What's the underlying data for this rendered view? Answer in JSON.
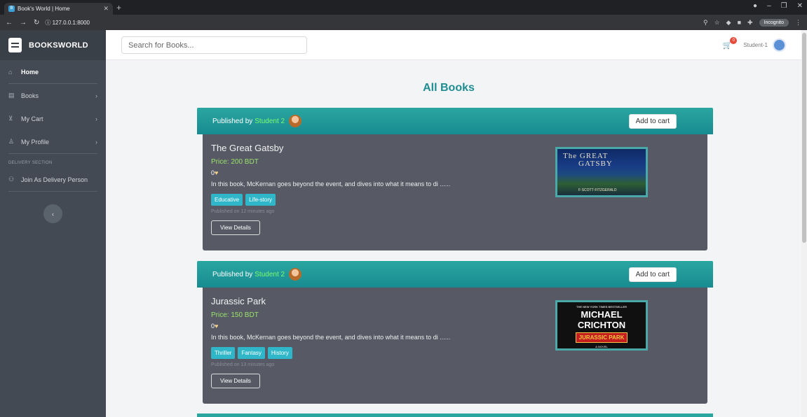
{
  "browser": {
    "tab_title": "Book's World | Home",
    "tab_close": "✕",
    "new_tab": "+",
    "url": "ⓘ 127.0.0.1:8000",
    "incognito_label": "Incognito"
  },
  "sidebar": {
    "brand": "BOOKSWORLD",
    "items": [
      {
        "label": "Home",
        "icon": "home-icon"
      },
      {
        "label": "Books",
        "icon": "book-icon"
      },
      {
        "label": "My Cart",
        "icon": "cart-icon"
      },
      {
        "label": "My Profile",
        "icon": "user-icon"
      }
    ],
    "section_heading": "DELIVERY SECTION",
    "delivery_item": "Join As Delivery Person"
  },
  "topbar": {
    "search_placeholder": "Search for Books...",
    "cart_count": "0",
    "username": "Student-1"
  },
  "main": {
    "title": "All Books",
    "published_by_label": "Published by",
    "add_to_cart_label": "Add to cart",
    "view_details_label": "View Details",
    "books": [
      {
        "publisher": "Student 2",
        "title": "The Great Gatsby",
        "price": "Price: 200 BDT",
        "likes": "0",
        "description": "In this book, McKernan goes beyond the event, and dives into what it means to di ......",
        "tags": [
          "Educative",
          "Life-story"
        ],
        "published": "Published on 12 minutes ago",
        "cover": {
          "line1": "The GREAT",
          "line2": "GATSBY",
          "author": "F·SCOTT·FITZGERALD"
        }
      },
      {
        "publisher": "Student 2",
        "title": "Jurassic Park",
        "price": "Price: 150 BDT",
        "likes": "0",
        "description": "In this book, McKernan goes beyond the event, and dives into what it means to di ......",
        "tags": [
          "Thriller",
          "Fantasy",
          "History"
        ],
        "published": "Published on 13 minutes ago",
        "cover": {
          "top": "THE NEW YORK TIMES BESTSELLER",
          "author1": "MICHAEL",
          "author2": "CRICHTON",
          "title": "JURASSIC PARK",
          "bottom": "A NOVEL"
        }
      }
    ]
  },
  "colors": {
    "accent": "#1f8d91",
    "sidebar": "#434a53",
    "card": "#575a65",
    "tag": "#2fb7c9"
  }
}
